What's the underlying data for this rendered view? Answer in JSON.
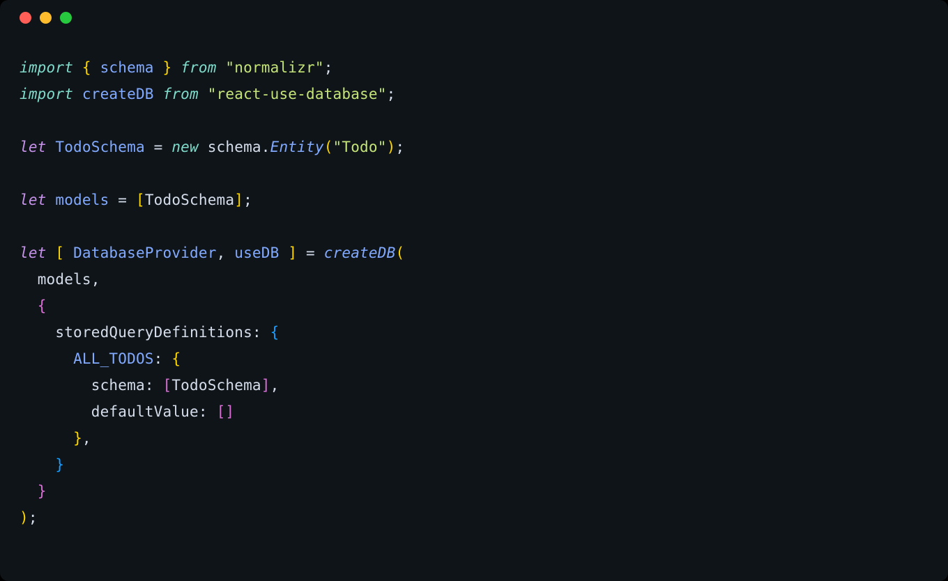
{
  "code": {
    "line1": {
      "import": "import",
      "lbrace": "{",
      "schema": "schema",
      "rbrace": "}",
      "from": "from",
      "pkg": "\"normalizr\"",
      "semi": ";"
    },
    "line2": {
      "import": "import",
      "createDB": "createDB",
      "from": "from",
      "pkg": "\"react-use-database\"",
      "semi": ";"
    },
    "line4": {
      "let": "let",
      "varname": "TodoSchema",
      "eq": "=",
      "new": "new",
      "schema": "schema",
      "dot": ".",
      "Entity": "Entity",
      "lparen": "(",
      "arg": "\"Todo\"",
      "rparen": ")",
      "semi": ";"
    },
    "line6": {
      "let": "let",
      "varname": "models",
      "eq": "=",
      "lbracket": "[",
      "TodoSchema": "TodoSchema",
      "rbracket": "]",
      "semi": ";"
    },
    "line8": {
      "let": "let",
      "lbracket": "[",
      "DatabaseProvider": "DatabaseProvider",
      "comma": ",",
      "useDB": "useDB",
      "rbracket": "]",
      "eq": "=",
      "createDB": "createDB",
      "lparen": "("
    },
    "line9": {
      "models": "models",
      "comma": ","
    },
    "line10": {
      "lbrace": "{"
    },
    "line11": {
      "prop": "storedQueryDefinitions",
      "colon": ":",
      "lbrace": "{"
    },
    "line12": {
      "prop": "ALL_TODOS",
      "colon": ":",
      "lbrace": "{"
    },
    "line13": {
      "prop": "schema",
      "colon": ":",
      "lbracket": "[",
      "TodoSchema": "TodoSchema",
      "rbracket": "]",
      "comma": ","
    },
    "line14": {
      "prop": "defaultValue",
      "colon": ":",
      "lbracket": "[",
      "rbracket": "]"
    },
    "line15": {
      "rbrace": "}",
      "comma": ","
    },
    "line16": {
      "rbrace": "}"
    },
    "line17": {
      "rbrace": "}"
    },
    "line18": {
      "rparen": ")",
      "semi": ";"
    }
  }
}
